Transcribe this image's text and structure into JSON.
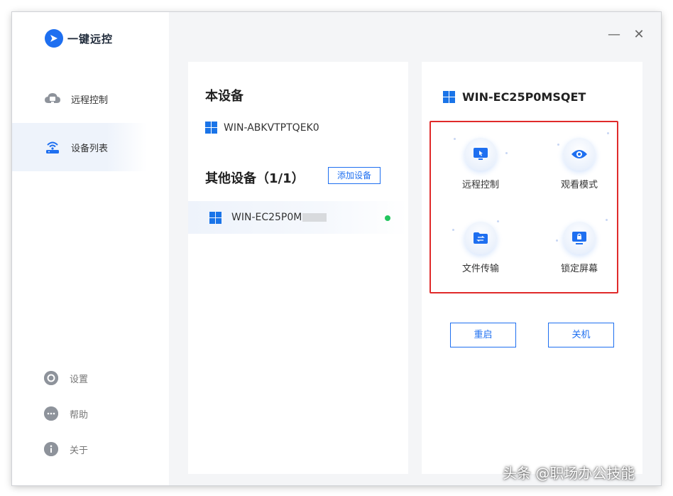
{
  "app": {
    "name": "一键远控"
  },
  "sidebar": {
    "nav": [
      {
        "label": "远程控制",
        "icon": "cloud-monitor-icon"
      },
      {
        "label": "设备列表",
        "icon": "router-wifi-icon"
      }
    ],
    "bottom": [
      {
        "label": "设置",
        "icon": "gear-icon"
      },
      {
        "label": "帮助",
        "icon": "help-chat-icon"
      },
      {
        "label": "关于",
        "icon": "info-icon"
      }
    ]
  },
  "window_controls": {
    "minimize": "—",
    "close": "✕"
  },
  "this_device": {
    "title": "本设备",
    "name": "WIN-ABKVTPTQEK0"
  },
  "other_devices": {
    "title": "其他设备（1/1）",
    "add_button": "添加设备",
    "items": [
      {
        "name": "WIN-EC25P0M",
        "status": "online"
      }
    ]
  },
  "selected_device": {
    "name": "WIN-EC25P0MSQET",
    "actions": [
      {
        "label": "远程控制",
        "icon": "remote-control-icon"
      },
      {
        "label": "观看模式",
        "icon": "eye-icon"
      },
      {
        "label": "文件传输",
        "icon": "folder-transfer-icon"
      },
      {
        "label": "锁定屏幕",
        "icon": "lock-screen-icon"
      }
    ],
    "restart_button": "重启",
    "shutdown_button": "关机"
  },
  "watermark": "头条 @职场办公技能",
  "colors": {
    "accent": "#1e6ff0",
    "highlight_border": "#e02a2a",
    "online": "#22c55e"
  }
}
